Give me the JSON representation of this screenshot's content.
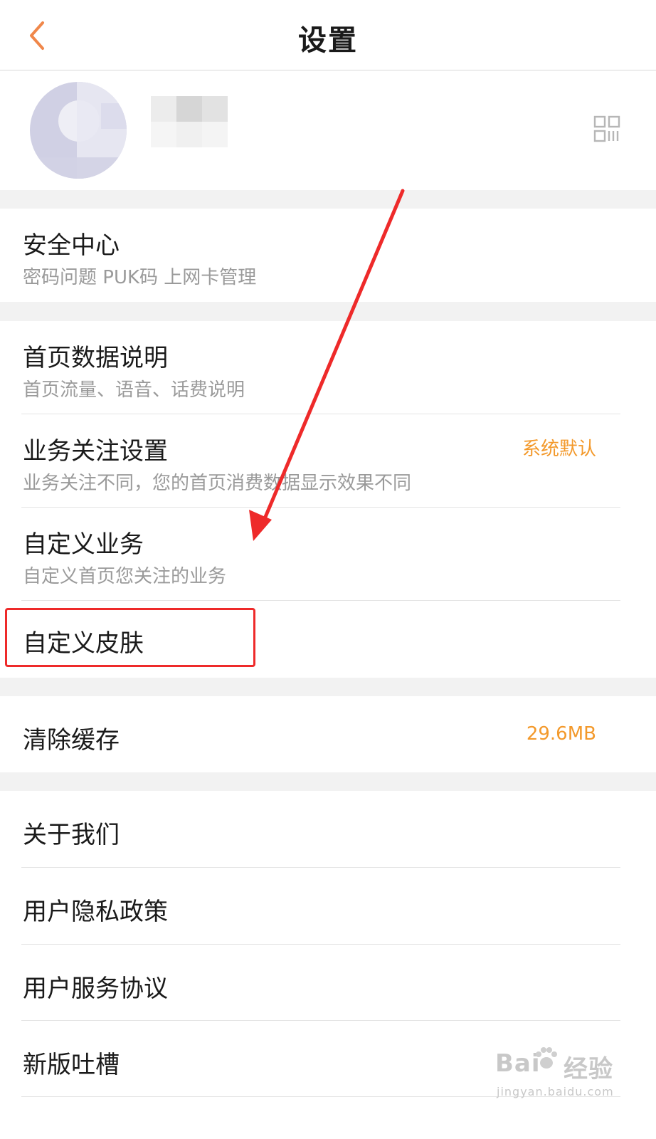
{
  "header": {
    "title": "设置",
    "back_icon": "chevron-left-icon"
  },
  "profile": {
    "avatar": "blurred",
    "qr_icon": "qr-code-icon"
  },
  "sections": {
    "security": {
      "title": "安全中心",
      "subtitle": "密码问题 PUK码 上网卡管理"
    },
    "home_data": {
      "title": "首页数据说明",
      "subtitle": "首页流量、语音、话费说明"
    },
    "business_follow": {
      "title": "业务关注设置",
      "subtitle": "业务关注不同，您的首页消费数据显示效果不同",
      "value": "系统默认"
    },
    "custom_business": {
      "title": "自定义业务",
      "subtitle": "自定义首页您关注的业务"
    },
    "custom_skin": {
      "title": "自定义皮肤"
    },
    "clear_cache": {
      "title": "清除缓存",
      "value": "29.6MB"
    },
    "about": {
      "title": "关于我们"
    },
    "privacy": {
      "title": "用户隐私政策"
    },
    "agreement": {
      "title": "用户服务协议"
    },
    "feedback": {
      "title": "新版吐槽"
    }
  },
  "annotation": {
    "color": "#ee2a2a",
    "target": "自定义皮肤"
  },
  "watermark": {
    "brand_left": "Bai",
    "brand_right": "经验",
    "url": "jingyan.baidu.com"
  },
  "colors": {
    "accent": "#f3992b",
    "back_icon": "#f0874a",
    "divider": "#e4e4e4",
    "section_gap": "#f2f2f2"
  }
}
